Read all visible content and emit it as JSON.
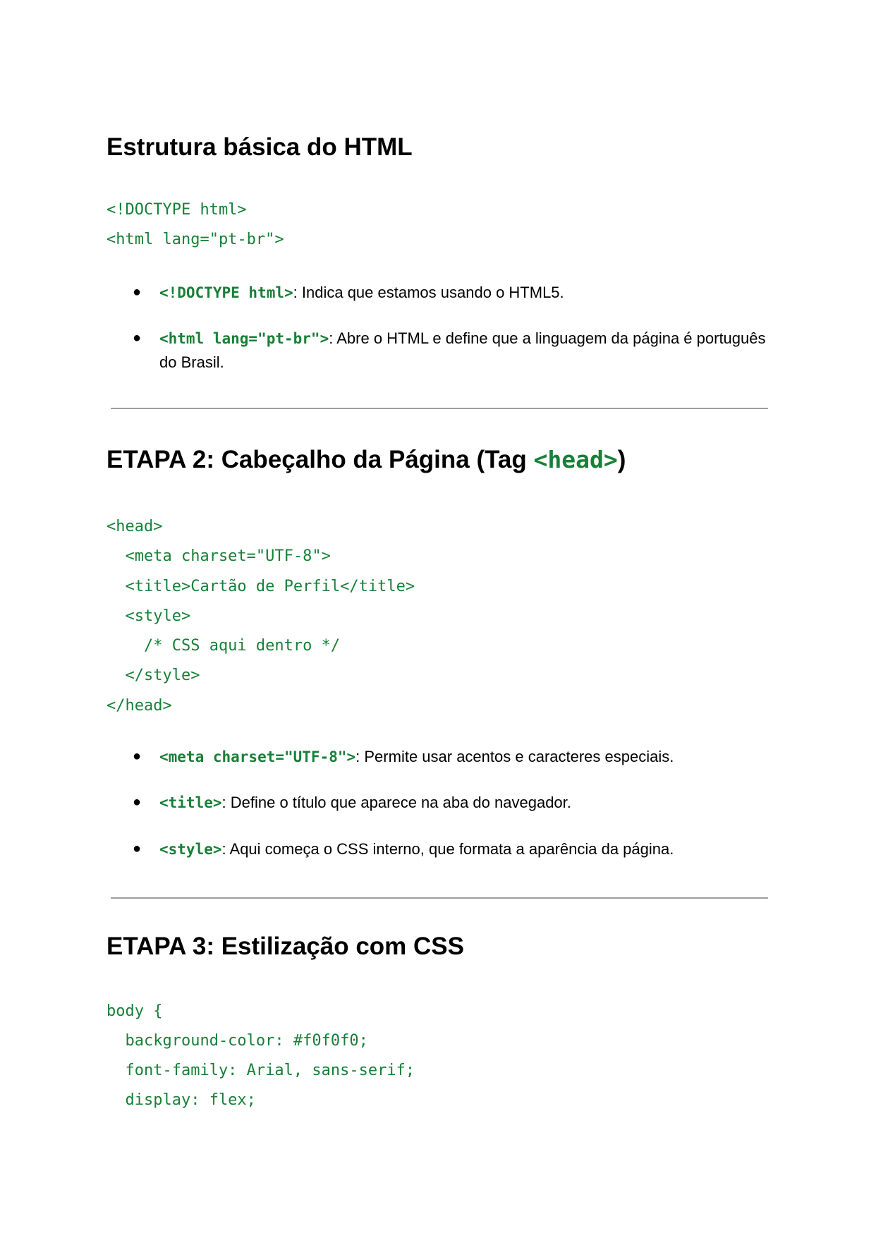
{
  "section1": {
    "title": "Estrutura básica do HTML",
    "code": [
      "<!DOCTYPE html>",
      "<html lang=\"pt-br\">"
    ],
    "bullets": [
      {
        "code": "<!DOCTYPE html>",
        "text": ": Indica que estamos usando o HTML5."
      },
      {
        "code": "<html lang=\"pt-br\">",
        "text": ": Abre o HTML e define que a linguagem da página é português do Brasil."
      }
    ]
  },
  "section2": {
    "title_prefix": "ETAPA 2: Cabeçalho da Página (Tag ",
    "title_code": "<head>",
    "title_suffix": ")",
    "code": [
      "<head>",
      "  <meta charset=\"UTF-8\">",
      "  <title>Cartão de Perfil</title>",
      "  <style>",
      "    /* CSS aqui dentro */",
      "  </style>",
      "</head>"
    ],
    "bullets": [
      {
        "code": "<meta charset=\"UTF-8\">",
        "text": ": Permite usar acentos e caracteres especiais."
      },
      {
        "code": "<title>",
        "text": ": Define o título que aparece na aba do navegador."
      },
      {
        "code": "<style>",
        "text": ": Aqui começa o CSS interno, que formata a aparência da página."
      }
    ]
  },
  "section3": {
    "title": "ETAPA 3: Estilização com CSS",
    "code": [
      "body {",
      "  background-color: #f0f0f0;",
      "  font-family: Arial, sans-serif;",
      "  display: flex;"
    ]
  },
  "colors": {
    "code_green": "#188038",
    "rule_gray": "#9e9e9e"
  }
}
